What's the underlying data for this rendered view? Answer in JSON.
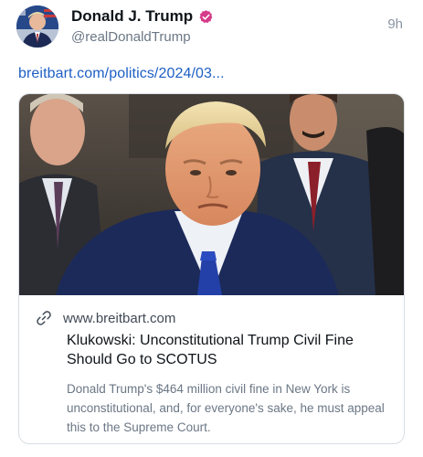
{
  "post": {
    "author": {
      "display_name": "Donald J. Trump",
      "handle": "@realDonaldTrump",
      "verified_icon": "verified-badge-icon",
      "verified_color": "#d63a8a"
    },
    "timestamp": "9h",
    "link_text": "breitbart.com/politics/2024/03...",
    "card": {
      "domain": "www.breitbart.com",
      "title": "Klukowski: Unconstitutional Trump Civil Fine Should Go to SCOTUS",
      "description": "Donald Trump's $464 million civil fine in New York is unconstitutional, and, for everyone's sake, he must appeal this to the Supreme Court.",
      "link_icon": "link-icon"
    }
  },
  "colors": {
    "link": "#1d5fc4",
    "secondary_text": "#6b7785",
    "border": "#d9dee3"
  }
}
